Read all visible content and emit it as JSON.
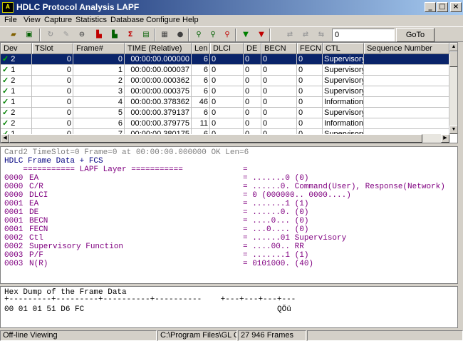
{
  "window": {
    "title": "HDLC Protocol Analysis LAPF",
    "icon_text": "A",
    "minimize": "_",
    "maximize": "□",
    "close": "×"
  },
  "menu": [
    "File",
    "View",
    "Capture",
    "Statistics",
    "Database",
    "Configure",
    "Help"
  ],
  "toolbar": {
    "frame_input": "0",
    "goto_label": "GoTo"
  },
  "grid": {
    "columns": [
      "Dev",
      "TSlot",
      "Frame#",
      "TIME (Relative)",
      "Len",
      "DLCI",
      "DE",
      "BECN",
      "FECN",
      "CTL",
      "Sequence Number"
    ],
    "rows": [
      {
        "dev": "2",
        "tslot": "0",
        "frame": "0",
        "time": "00:00:00.000000",
        "len": "6",
        "dlci": "0",
        "de": "0",
        "becn": "0",
        "fecn": "0",
        "ctl": "Supervisory"
      },
      {
        "dev": "1",
        "tslot": "0",
        "frame": "1",
        "time": "00:00:00.000037",
        "len": "6",
        "dlci": "0",
        "de": "0",
        "becn": "0",
        "fecn": "0",
        "ctl": "Supervisory"
      },
      {
        "dev": "2",
        "tslot": "0",
        "frame": "2",
        "time": "00:00:00.000362",
        "len": "6",
        "dlci": "0",
        "de": "0",
        "becn": "0",
        "fecn": "0",
        "ctl": "Supervisory"
      },
      {
        "dev": "1",
        "tslot": "0",
        "frame": "3",
        "time": "00:00:00.000375",
        "len": "6",
        "dlci": "0",
        "de": "0",
        "becn": "0",
        "fecn": "0",
        "ctl": "Supervisory"
      },
      {
        "dev": "1",
        "tslot": "0",
        "frame": "4",
        "time": "00:00:00.378362",
        "len": "46",
        "dlci": "0",
        "de": "0",
        "becn": "0",
        "fecn": "0",
        "ctl": "Information"
      },
      {
        "dev": "2",
        "tslot": "0",
        "frame": "5",
        "time": "00:00:00.379137",
        "len": "6",
        "dlci": "0",
        "de": "0",
        "becn": "0",
        "fecn": "0",
        "ctl": "Supervisory"
      },
      {
        "dev": "2",
        "tslot": "0",
        "frame": "6",
        "time": "00:00:00.379775",
        "len": "11",
        "dlci": "0",
        "de": "0",
        "becn": "0",
        "fecn": "0",
        "ctl": "Information"
      },
      {
        "dev": "1",
        "tslot": "0",
        "frame": "7",
        "time": "00:00:00.380175",
        "len": "6",
        "dlci": "0",
        "de": "0",
        "becn": "0",
        "fecn": "0",
        "ctl": "Supervisory"
      }
    ]
  },
  "detail": {
    "header": "Card2 TimeSlot=0 Frame=0 at 00:00:00.000000 OK Len=6",
    "subheader": "HDLC Frame Data + FCS",
    "layer_title": "    =========== LAPF Layer ===========",
    "layer_eq": "=",
    "fields": [
      {
        "off": "0000",
        "name": "EA",
        "value": "= .......0 (0)"
      },
      {
        "off": "0000",
        "name": "C/R",
        "value": "= ......0. Command(User), Response(Network)"
      },
      {
        "off": "0000",
        "name": "DLCI",
        "value": "= 0 (000000.. 0000....)"
      },
      {
        "off": "0001",
        "name": "EA",
        "value": "= .......1 (1)"
      },
      {
        "off": "0001",
        "name": "DE",
        "value": "= ......0. (0)"
      },
      {
        "off": "0001",
        "name": "BECN",
        "value": "= ....0... (0)"
      },
      {
        "off": "0001",
        "name": "FECN",
        "value": "= ...0.... (0)"
      },
      {
        "off": "0002",
        "name": "Ctl",
        "value": "= ......01 Supervisory"
      },
      {
        "off": "0002",
        "name": "Supervisory Function",
        "value": "= ....00.. RR"
      },
      {
        "off": "0003",
        "name": "P/F",
        "value": "= .......1 (1)"
      },
      {
        "off": "0003",
        "name": "N(R)",
        "value": "= 0101000. (40)"
      }
    ]
  },
  "hex": {
    "title": "Hex Dump of the Frame Data",
    "ruler": "+---------+---------+----------+----------    +---+---+---+---",
    "bytes": "00 01 01 51 D6 FC",
    "ascii": "QÖü"
  },
  "status": {
    "mode": "Off-line Viewing",
    "path": "C:\\Program Files\\GL Communications",
    "frames": "27 946 Frames"
  }
}
